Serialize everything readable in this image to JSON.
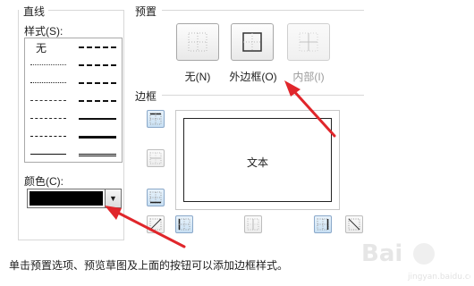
{
  "line_section": {
    "title": "直线",
    "style_label": "样式(S):",
    "none_label": "无",
    "color_label": "颜色(C):",
    "color_value": "#000000"
  },
  "preset_section": {
    "title": "预置",
    "buttons": [
      {
        "label": "无(N)",
        "icon": "preset-none-icon"
      },
      {
        "label": "外边框(O)",
        "icon": "preset-outline-icon"
      },
      {
        "label": "内部(I)",
        "icon": "preset-inside-icon"
      }
    ]
  },
  "border_section": {
    "title": "边框",
    "preview_text": "文本"
  },
  "hint": "单击预置选项、预览草图及上面的按钮可以添加边框样式。",
  "colors": {
    "annotation_arrow": "#e0262b",
    "button_active": "#c7dff3"
  }
}
